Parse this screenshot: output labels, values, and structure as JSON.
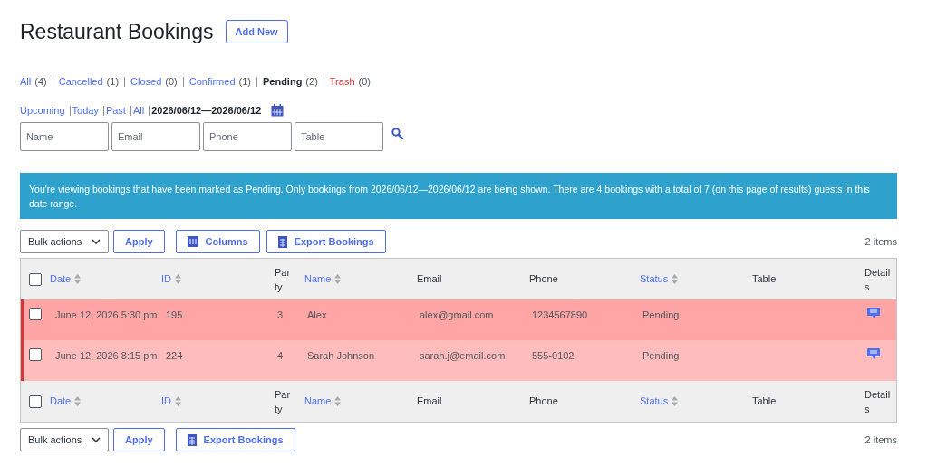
{
  "title": "Restaurant Bookings",
  "add_new": "Add New",
  "status_filters": [
    {
      "label": "All",
      "count": "(4)",
      "selected": false,
      "kind": "normal"
    },
    {
      "label": "Cancelled",
      "count": "(1)",
      "selected": false,
      "kind": "normal"
    },
    {
      "label": "Closed",
      "count": "(0)",
      "selected": false,
      "kind": "normal"
    },
    {
      "label": "Confirmed",
      "count": "(1)",
      "selected": false,
      "kind": "normal"
    },
    {
      "label": "Pending",
      "count": "(2)",
      "selected": true,
      "kind": "normal"
    },
    {
      "label": "Trash",
      "count": "(0)",
      "selected": false,
      "kind": "trash"
    }
  ],
  "date_filters": [
    {
      "label": "Upcoming",
      "selected": false
    },
    {
      "label": "Today",
      "selected": false
    },
    {
      "label": "Past",
      "selected": false
    },
    {
      "label": "All",
      "selected": false
    },
    {
      "label": "2026/06/12—2026/06/12",
      "selected": true
    }
  ],
  "search_fields": [
    {
      "placeholder": "Name"
    },
    {
      "placeholder": "Email"
    },
    {
      "placeholder": "Phone"
    },
    {
      "placeholder": "Table"
    }
  ],
  "notice": "You're viewing bookings that have been marked as Pending. Only bookings from 2026/06/12—2026/06/12 are being shown. There are 4 bookings with a total of 7 (on this page of results) guests in this date range.",
  "top_toolbar": {
    "bulk_actions": "Bulk actions",
    "apply": "Apply",
    "columns": "Columns",
    "export": "Export Bookings",
    "items": "2 items"
  },
  "table": {
    "header": {
      "checked": false,
      "columns": [
        {
          "label": "Date",
          "sortable": true
        },
        {
          "label": "ID",
          "sortable": true
        },
        {
          "label": "Party",
          "sortable": false
        },
        {
          "label": "Name",
          "sortable": true
        },
        {
          "label": "Email",
          "sortable": false
        },
        {
          "label": "Phone",
          "sortable": false
        },
        {
          "label": "Status",
          "sortable": true
        },
        {
          "label": "Table",
          "sortable": false
        },
        {
          "label": "Details",
          "sortable": false
        }
      ]
    },
    "footer": {
      "checked": false,
      "columns": [
        {
          "label": "Date",
          "sortable": true
        },
        {
          "label": "ID",
          "sortable": true
        },
        {
          "label": "Party",
          "sortable": false
        },
        {
          "label": "Name",
          "sortable": true
        },
        {
          "label": "Email",
          "sortable": false
        },
        {
          "label": "Phone",
          "sortable": false
        },
        {
          "label": "Status",
          "sortable": true
        },
        {
          "label": "Table",
          "sortable": false
        },
        {
          "label": "Details",
          "sortable": false
        }
      ]
    },
    "rows": [
      {
        "checked": false,
        "color": "#ffa5a5",
        "cells": [
          "June 12, 2026 5:30 pm",
          "195",
          "3",
          "Alex",
          "alex@gmail.com",
          "1234567890",
          "Pending",
          ""
        ]
      },
      {
        "checked": false,
        "color": "#ffbcbc",
        "cells": [
          "June 12, 2026 8:15 pm",
          "224",
          "4",
          "Sarah Johnson",
          "sarah.j@email.com",
          "555-0102",
          "Pending",
          ""
        ]
      }
    ]
  },
  "bottom_toolbar": {
    "bulk_actions": "Bulk actions",
    "apply": "Apply",
    "export": "Export Bookings",
    "items": "2 items"
  }
}
